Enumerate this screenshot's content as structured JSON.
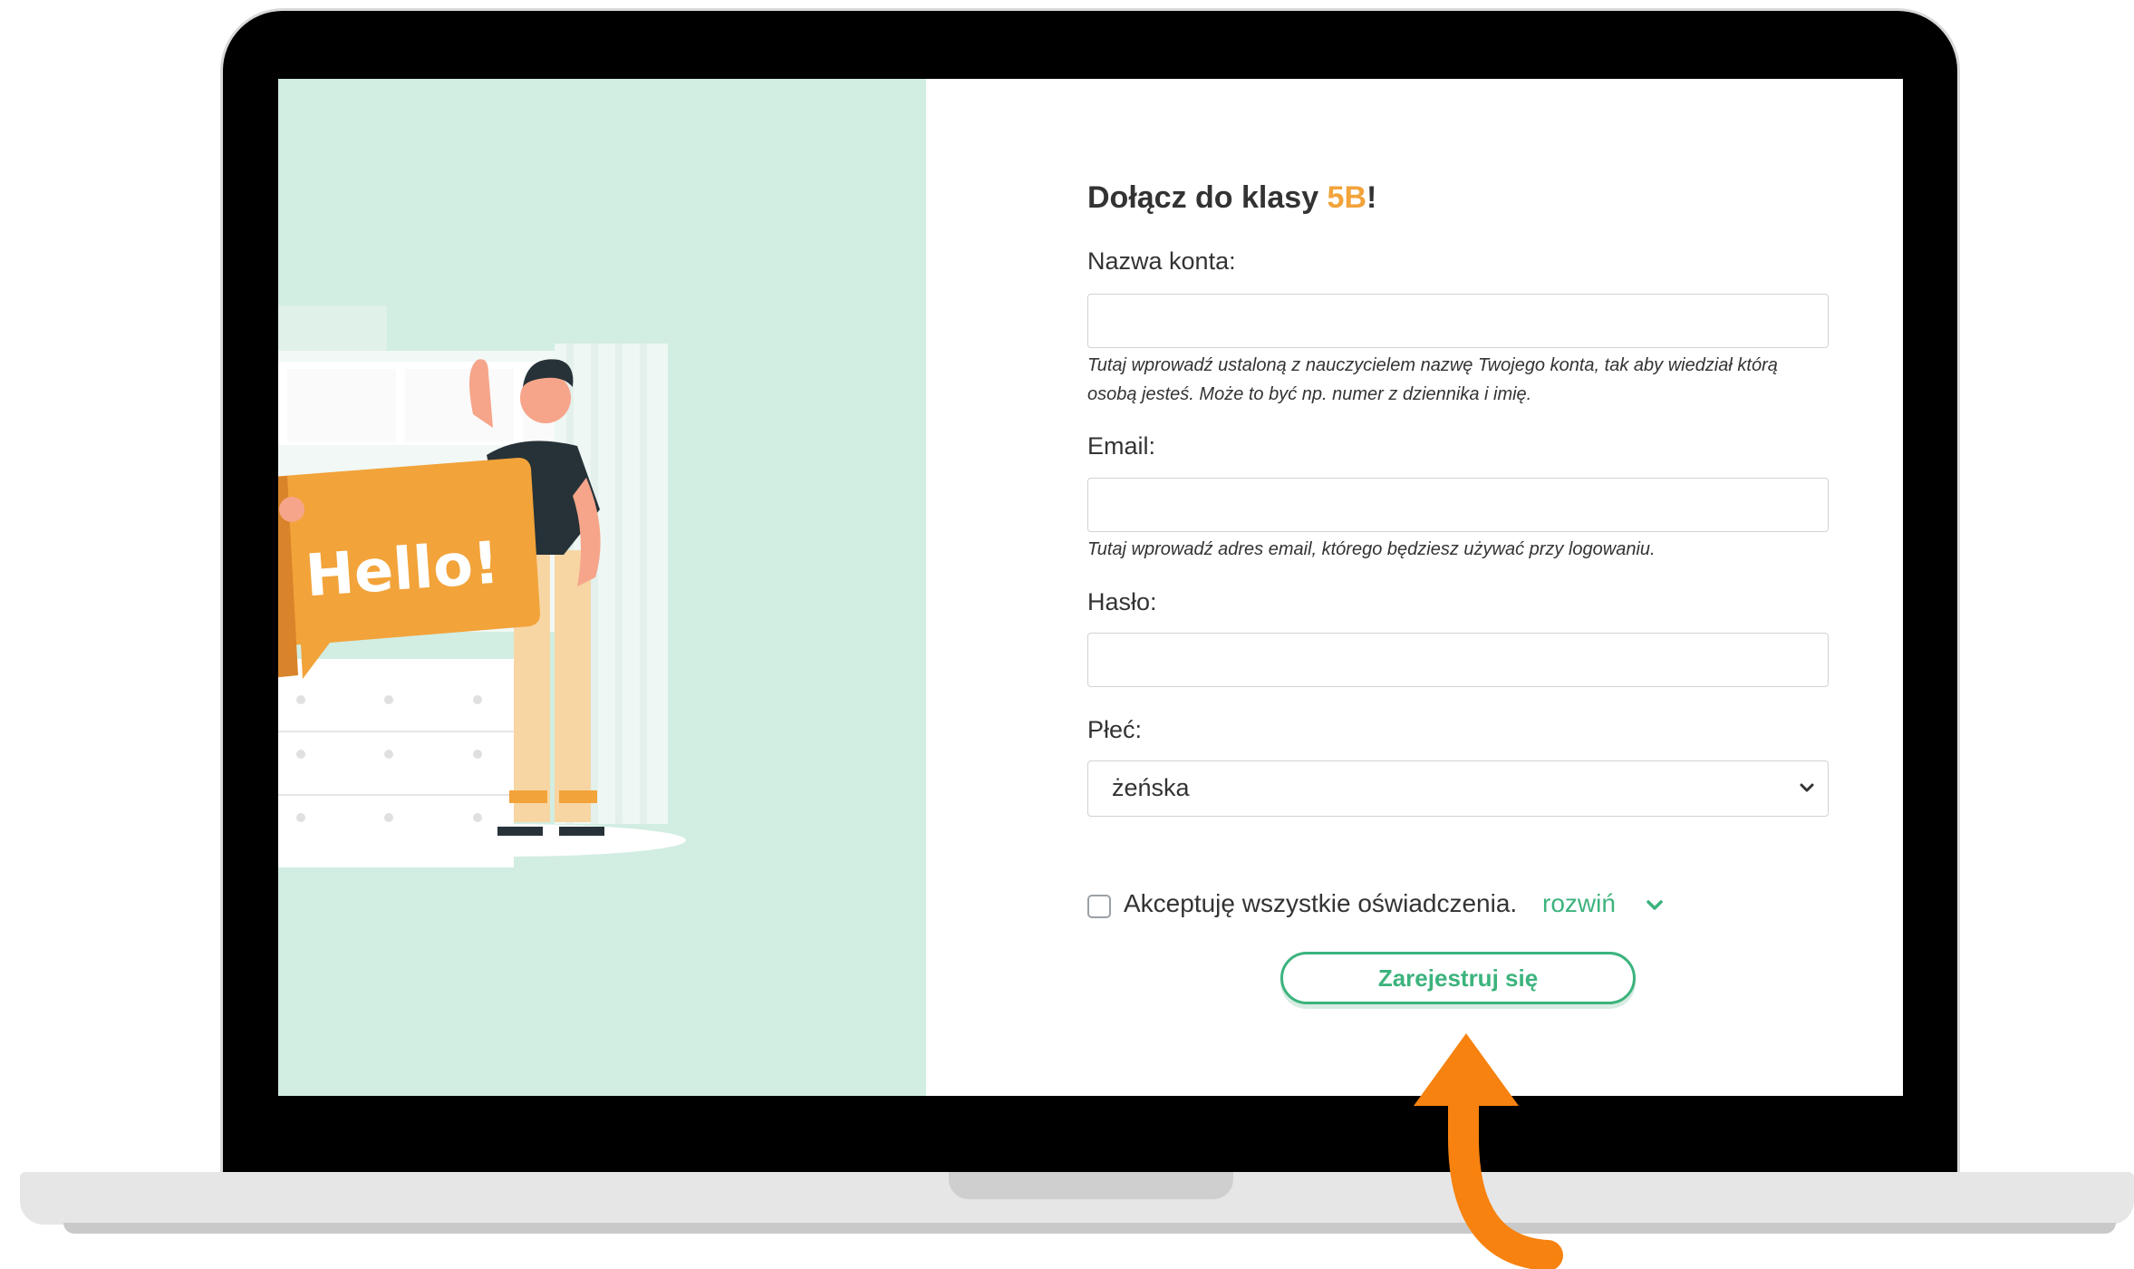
{
  "form": {
    "title_prefix": "Dołącz do klasy ",
    "class_name": "5B",
    "title_suffix": "!",
    "account_label": "Nazwa konta:",
    "account_value": "",
    "account_hint": "Tutaj wprowadź ustaloną z nauczycielem nazwę Twojego konta, tak aby wiedział którą osobą jesteś. Może to być np. numer z dziennika i imię.",
    "email_label": "Email:",
    "email_value": "",
    "email_hint": "Tutaj wprowadź adres email, którego będziesz używać przy logowaniu.",
    "password_label": "Hasło:",
    "password_value": "",
    "gender_label": "Płeć:",
    "gender_selected": "żeńska",
    "accept_label": "Akceptuję wszystkie oświadczenia.",
    "expand_link": "rozwiń",
    "submit_label": "Zarejestruj się"
  },
  "illustration": {
    "sign_text": "Hello!"
  },
  "colors": {
    "accent_green": "#3cb37d",
    "class_orange": "#f2a33a",
    "panel_mint": "#d2ede2",
    "arrow_orange": "#f7820f"
  }
}
